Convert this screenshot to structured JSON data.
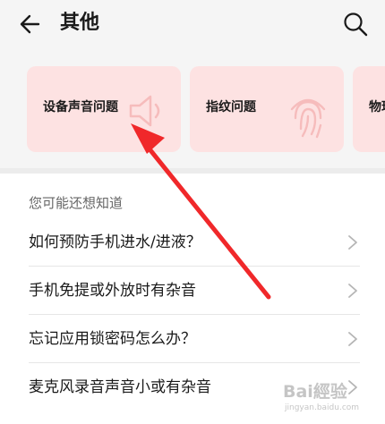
{
  "header": {
    "title": "其他",
    "back_icon": "arrow-left-icon",
    "search_icon": "search-icon"
  },
  "cards": [
    {
      "label": "设备声音问题",
      "icon": "speaker-icon"
    },
    {
      "label": "指纹问题",
      "icon": "fingerprint-icon"
    },
    {
      "label": "物理",
      "icon": ""
    }
  ],
  "section": {
    "title": "您可能还想知道"
  },
  "list": [
    {
      "label": "如何预防手机进水/进液？"
    },
    {
      "label": "手机免提或外放时有杂音"
    },
    {
      "label": "忘记应用锁密码怎么办？"
    },
    {
      "label": "麦克风录音声音小或有杂音"
    }
  ],
  "watermark": {
    "logo": "Bai經验",
    "sub": "jingyan.baidu.com"
  },
  "colors": {
    "card_bg": "#fde2e2",
    "annotation_arrow": "#f0282a",
    "section_title": "#666666"
  }
}
